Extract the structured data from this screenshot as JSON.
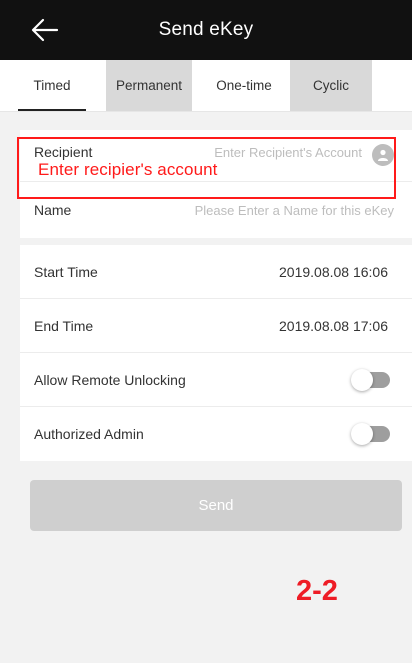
{
  "header": {
    "title": "Send eKey"
  },
  "tabs": [
    {
      "label": "Timed",
      "active": true
    },
    {
      "label": "Permanent",
      "active": false
    },
    {
      "label": "One-time",
      "active": false
    },
    {
      "label": "Cyclic",
      "active": false
    }
  ],
  "form": {
    "recipient": {
      "label": "Recipient",
      "placeholder": "Enter Recipient's Account"
    },
    "name": {
      "label": "Name",
      "placeholder": "Please Enter a Name for this eKey"
    },
    "start_time": {
      "label": "Start Time",
      "value": "2019.08.08 16:06"
    },
    "end_time": {
      "label": "End Time",
      "value": "2019.08.08 17:06"
    },
    "allow_remote_unlocking": {
      "label": "Allow Remote Unlocking",
      "enabled": false
    },
    "authorized_admin": {
      "label": "Authorized Admin",
      "enabled": false
    }
  },
  "send_label": "Send",
  "annotation": {
    "text": "Enter recipier's account",
    "step": "2-2"
  },
  "colors": {
    "annotation": "#ff1a1a",
    "step_number": "#ee1c25",
    "header_bg": "#111111"
  },
  "icons": {
    "back": "arrow-left-icon",
    "contacts": "contact-person-icon"
  }
}
